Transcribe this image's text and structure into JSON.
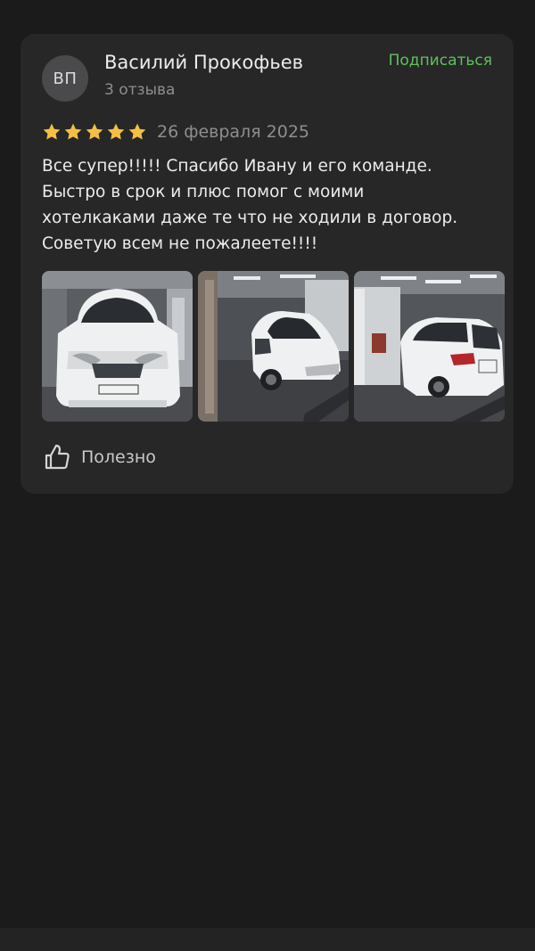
{
  "review": {
    "author": {
      "initials": "ВП",
      "name": "Василий Прокофьев",
      "reviews_count": "3 отзыва"
    },
    "subscribe_label": "Подписаться",
    "rating": 5,
    "date": "26 февраля 2025",
    "text": "Все супер!!!!! Спасибо Ивану и его команде.\nБыстро в срок и плюс помог с моими\nхотелкаками даже те что не ходили в договор.\nСоветую всем не пожалеете!!!!",
    "photos": [
      {
        "name": "car-photo-front"
      },
      {
        "name": "car-photo-side-front"
      },
      {
        "name": "car-photo-rear"
      }
    ],
    "helpful_label": "Полезно"
  },
  "colors": {
    "background": "#1b1b1c",
    "card": "#272728",
    "accent_green": "#5ec25a",
    "star": "#f4c043",
    "muted_text": "#8e8e90"
  },
  "icons": {
    "star": "star-icon",
    "helpful": "thumbs-up-icon"
  }
}
